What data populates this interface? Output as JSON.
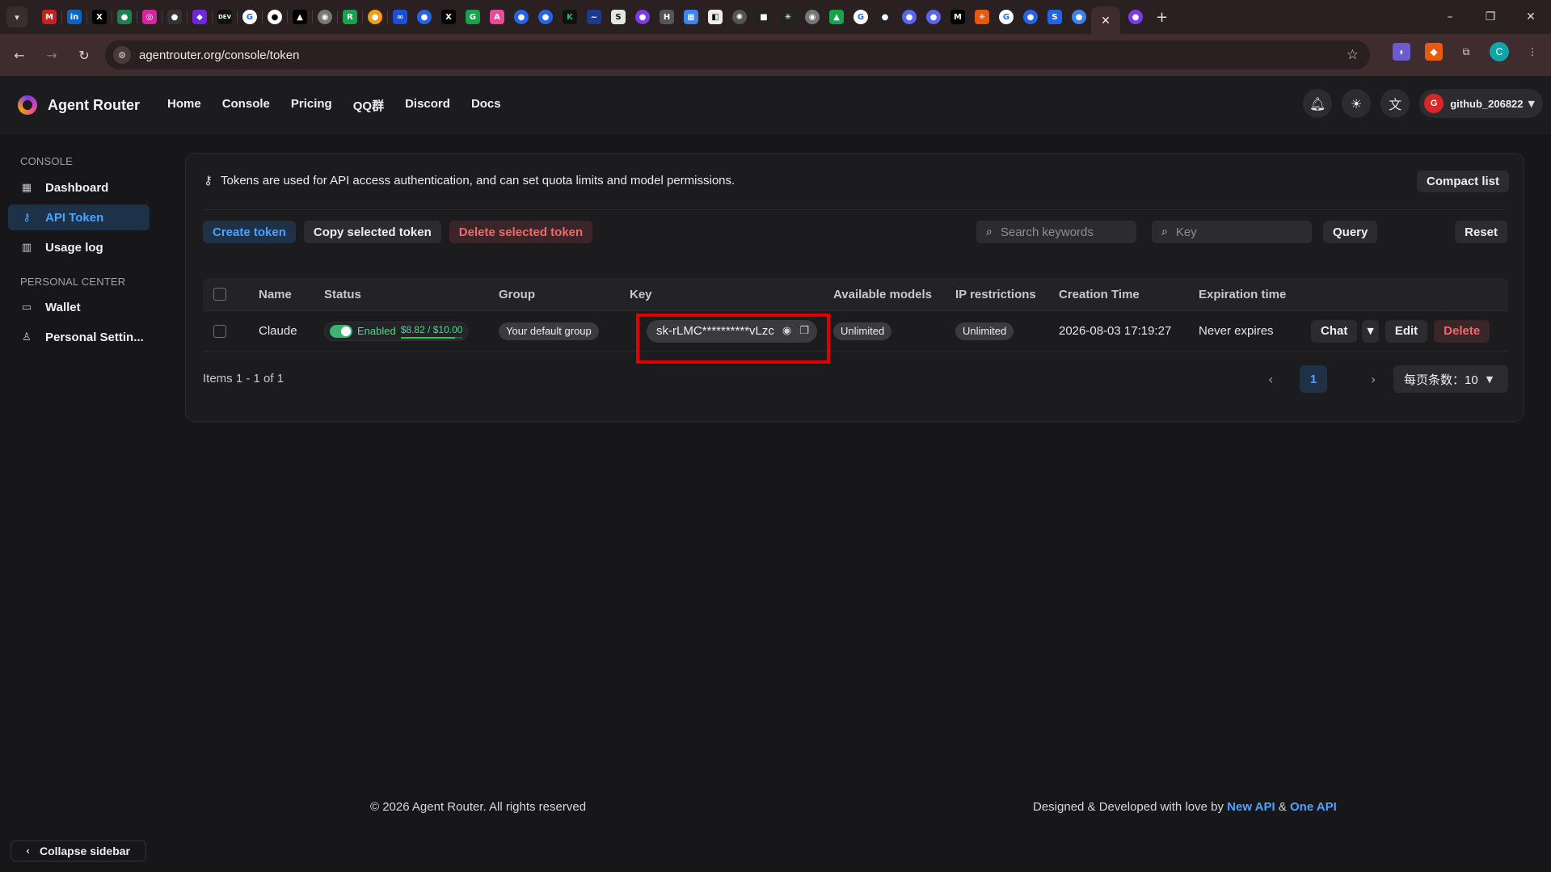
{
  "browser": {
    "url": "agentrouter.org/console/token",
    "tab_close": "✕",
    "new_tab": "+",
    "profile_initial": "C",
    "window_controls": [
      "–",
      "❐",
      "✕"
    ]
  },
  "header": {
    "brand": "Agent Router",
    "nav": [
      "Home",
      "Console",
      "Pricing",
      "QQ群",
      "Discord",
      "Docs"
    ],
    "user": "github_206822",
    "user_initial": "G"
  },
  "sidebar": {
    "console_section": "CONSOLE",
    "personal_section": "PERSONAL CENTER",
    "items": [
      {
        "label": "Dashboard"
      },
      {
        "label": "API Token"
      },
      {
        "label": "Usage log"
      },
      {
        "label": "Wallet"
      },
      {
        "label": "Personal Settin..."
      }
    ],
    "collapse": "Collapse sidebar"
  },
  "main": {
    "info": "Tokens are used for API access authentication, and can set quota limits and model permissions.",
    "compact_list": "Compact list",
    "create_token": "Create token",
    "copy_selected": "Copy selected token",
    "delete_selected": "Delete selected token",
    "search_placeholder": "Search keywords",
    "key_placeholder": "Key",
    "query": "Query",
    "reset": "Reset"
  },
  "table": {
    "headers": [
      "Name",
      "Status",
      "Group",
      "Key",
      "Available models",
      "IP restrictions",
      "Creation Time",
      "Expiration time"
    ],
    "rows": [
      {
        "name": "Claude",
        "status": "Enabled",
        "quota": "$8.82 / $10.00",
        "quota_fraction": 0.882,
        "group": "Your default group",
        "key": "sk-rLMC**********vLzc",
        "models": "Unlimited",
        "ip": "Unlimited",
        "created": "2026-08-03 17:19:27",
        "expires": "Never expires",
        "actions": {
          "chat": "Chat",
          "edit": "Edit",
          "delete": "Delete"
        }
      }
    ]
  },
  "pagination": {
    "items_text": "Items 1 - 1 of 1",
    "current_page": "1",
    "page_size": "每页条数：10"
  },
  "footer": {
    "copyright": "© 2026 Agent Router. All rights reserved",
    "credit_prefix": "Designed & Developed with love by",
    "link1": "New API",
    "amp": "&",
    "link2": "One API"
  }
}
